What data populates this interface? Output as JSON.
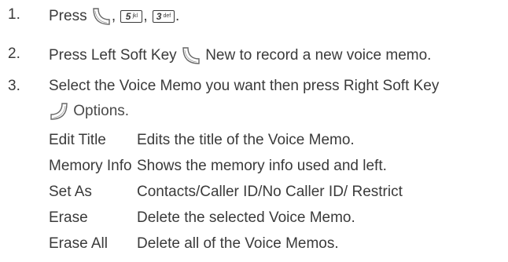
{
  "steps": [
    {
      "number": "1.",
      "prefix": "Press",
      "key1": {
        "digit": "5",
        "letters": "jkl"
      },
      "key2": {
        "digit": "3",
        "letters": "def"
      },
      "sep": ",",
      "end": "."
    },
    {
      "number": "2.",
      "before": "Press Left Soft Key",
      "after": "New to record a new voice memo."
    },
    {
      "number": "3.",
      "line1": "Select the Voice Memo you want then press Right Soft Key",
      "line2": "Options."
    }
  ],
  "options": [
    {
      "name": "Edit Title",
      "desc": "Edits the title of the Voice Memo."
    },
    {
      "name": "Memory Info",
      "desc": "Shows the memory info used and left."
    },
    {
      "name": "Set As",
      "desc": "Contacts/Caller ID/No Caller ID/ Restrict"
    },
    {
      "name": "Erase",
      "desc": "Delete the selected Voice Memo."
    },
    {
      "name": "Erase All",
      "desc": "Delete all of the Voice Memos."
    }
  ],
  "icons": {
    "left_soft_key": "left-soft-key-icon",
    "right_soft_key": "right-soft-key-icon"
  }
}
